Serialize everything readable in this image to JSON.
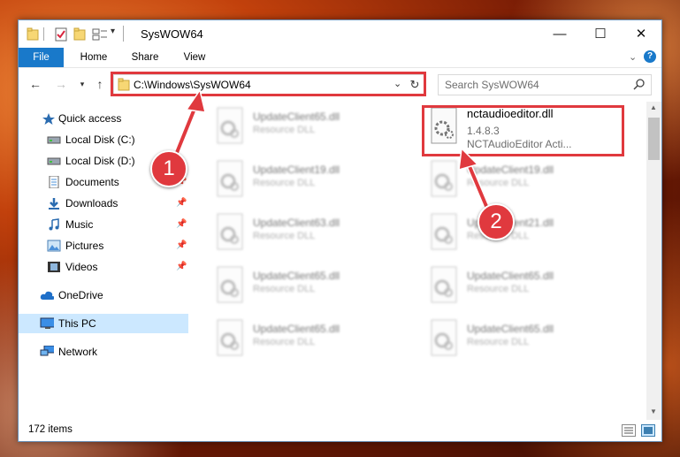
{
  "window": {
    "title": "SysWOW64",
    "controls": {
      "minimize": "—",
      "maximize": "☐",
      "close": "✕"
    }
  },
  "ribbon": {
    "tabs": [
      "File",
      "Home",
      "Share",
      "View"
    ],
    "help": "?"
  },
  "address": {
    "path": "C:\\Windows\\SysWOW64",
    "search_placeholder": "Search SysWOW64"
  },
  "nav": {
    "items": [
      {
        "label": "Quick access",
        "icon": "star-icon"
      },
      {
        "label": "Local Disk (C:)",
        "icon": "drive-icon"
      },
      {
        "label": "Local Disk (D:)",
        "icon": "drive-icon"
      },
      {
        "label": "Documents",
        "icon": "documents-icon"
      },
      {
        "label": "Downloads",
        "icon": "download-icon"
      },
      {
        "label": "Music",
        "icon": "music-icon"
      },
      {
        "label": "Pictures",
        "icon": "pictures-icon"
      },
      {
        "label": "Videos",
        "icon": "videos-icon"
      },
      {
        "label": "OneDrive",
        "icon": "cloud-icon"
      },
      {
        "label": "This PC",
        "icon": "computer-icon"
      },
      {
        "label": "Network",
        "icon": "network-icon"
      }
    ]
  },
  "files": {
    "selected": {
      "name": "nctaudioeditor.dll",
      "version": "1.4.8.3",
      "description": "NCTAudioEditor Acti..."
    },
    "left_column": [
      {
        "name": "UpdateClient65.dll",
        "type": "Resource DLL"
      },
      {
        "name": "UpdateClient19.dll",
        "type": "Resource DLL"
      },
      {
        "name": "UpdateClient63.dll",
        "type": "Resource DLL"
      },
      {
        "name": "UpdateClient65.dll",
        "type": "Resource DLL"
      },
      {
        "name": "UpdateClient65.dll",
        "type": "Resource DLL"
      }
    ],
    "right_column": [
      {
        "name": "UpdateClient19.dll",
        "type": "Resource DLL"
      },
      {
        "name": "UpdateClient21.dll",
        "type": "Resource DLL"
      },
      {
        "name": "UpdateClient65.dll",
        "type": "Resource DLL"
      },
      {
        "name": "UpdateClient65.dll",
        "type": "Resource DLL"
      }
    ]
  },
  "status": {
    "count": "172 items"
  },
  "callouts": {
    "one": "1",
    "two": "2"
  },
  "colors": {
    "accent": "#1979ca",
    "highlight": "#e0393e",
    "selection": "#cce8ff"
  }
}
